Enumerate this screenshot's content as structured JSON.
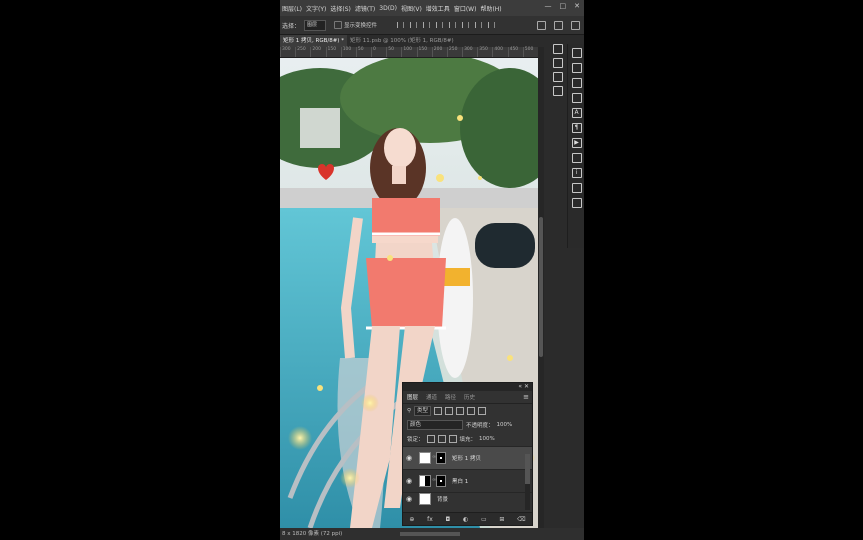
{
  "menubar": {
    "items": [
      "图层(L)",
      "文字(Y)",
      "选择(S)",
      "滤镜(T)",
      "3D(D)",
      "视图(V)",
      "增效工具",
      "窗口(W)",
      "帮助(H)"
    ],
    "window_controls": [
      "—",
      "□",
      "✕"
    ]
  },
  "options_bar": {
    "select_label": "选择：",
    "select_value": "图层",
    "show_transform_label": "显示变换控件"
  },
  "tabs": [
    {
      "label": "矩形 1 拷贝, RGB/8#) *",
      "active": true
    },
    {
      "label": "矩形 11.psb @ 100% (矩形 1, RGB/8#)",
      "active": false
    }
  ],
  "ruler": [
    "300",
    "250",
    "200",
    "150",
    "100",
    "50",
    "0",
    "50",
    "100",
    "150",
    "200",
    "250",
    "300",
    "350",
    "400",
    "450",
    "500"
  ],
  "status_bar": {
    "text": "8 x 1820 像素 (72 ppi)"
  },
  "layers_panel": {
    "tabs": [
      "图层",
      "通道",
      "路径",
      "历史"
    ],
    "active_tab": "图层",
    "filter_label": "类型",
    "blend_mode": "颜色",
    "opacity_label": "不透明度：",
    "opacity_value": "100%",
    "lock_label": "锁定：",
    "fill_label": "填充：",
    "fill_value": "100%",
    "layers": [
      {
        "name": "矩形 1 拷贝",
        "selected": true,
        "visible": true
      },
      {
        "name": "黑白 1",
        "selected": false,
        "visible": true
      },
      {
        "name": "背景",
        "selected": false,
        "visible": false
      }
    ],
    "footer_icons": [
      "link-icon",
      "fx-icon",
      "mask-icon",
      "adjustment-icon",
      "folder-icon",
      "new-layer-icon",
      "trash-icon"
    ]
  },
  "right_dock_icons": [
    "3d-icon",
    "table-icon",
    "swatch-icon",
    "grid-icon"
  ],
  "right_toolbar_icons": [
    "brush-tool-icon",
    "sliders-icon",
    "circle-icon",
    "copy-icon",
    "text-tool-icon",
    "paragraph-icon",
    "play-icon",
    "doc-icon",
    "info-icon",
    "cursor-icon",
    "comment-icon"
  ],
  "colors": {
    "app_bg": "#2b2b2b",
    "menubar_bg": "#3c3c3c",
    "selected_layer": "#4a4a4a",
    "swimsuit": "#f27a6e",
    "pool": "#4fb5c8"
  }
}
